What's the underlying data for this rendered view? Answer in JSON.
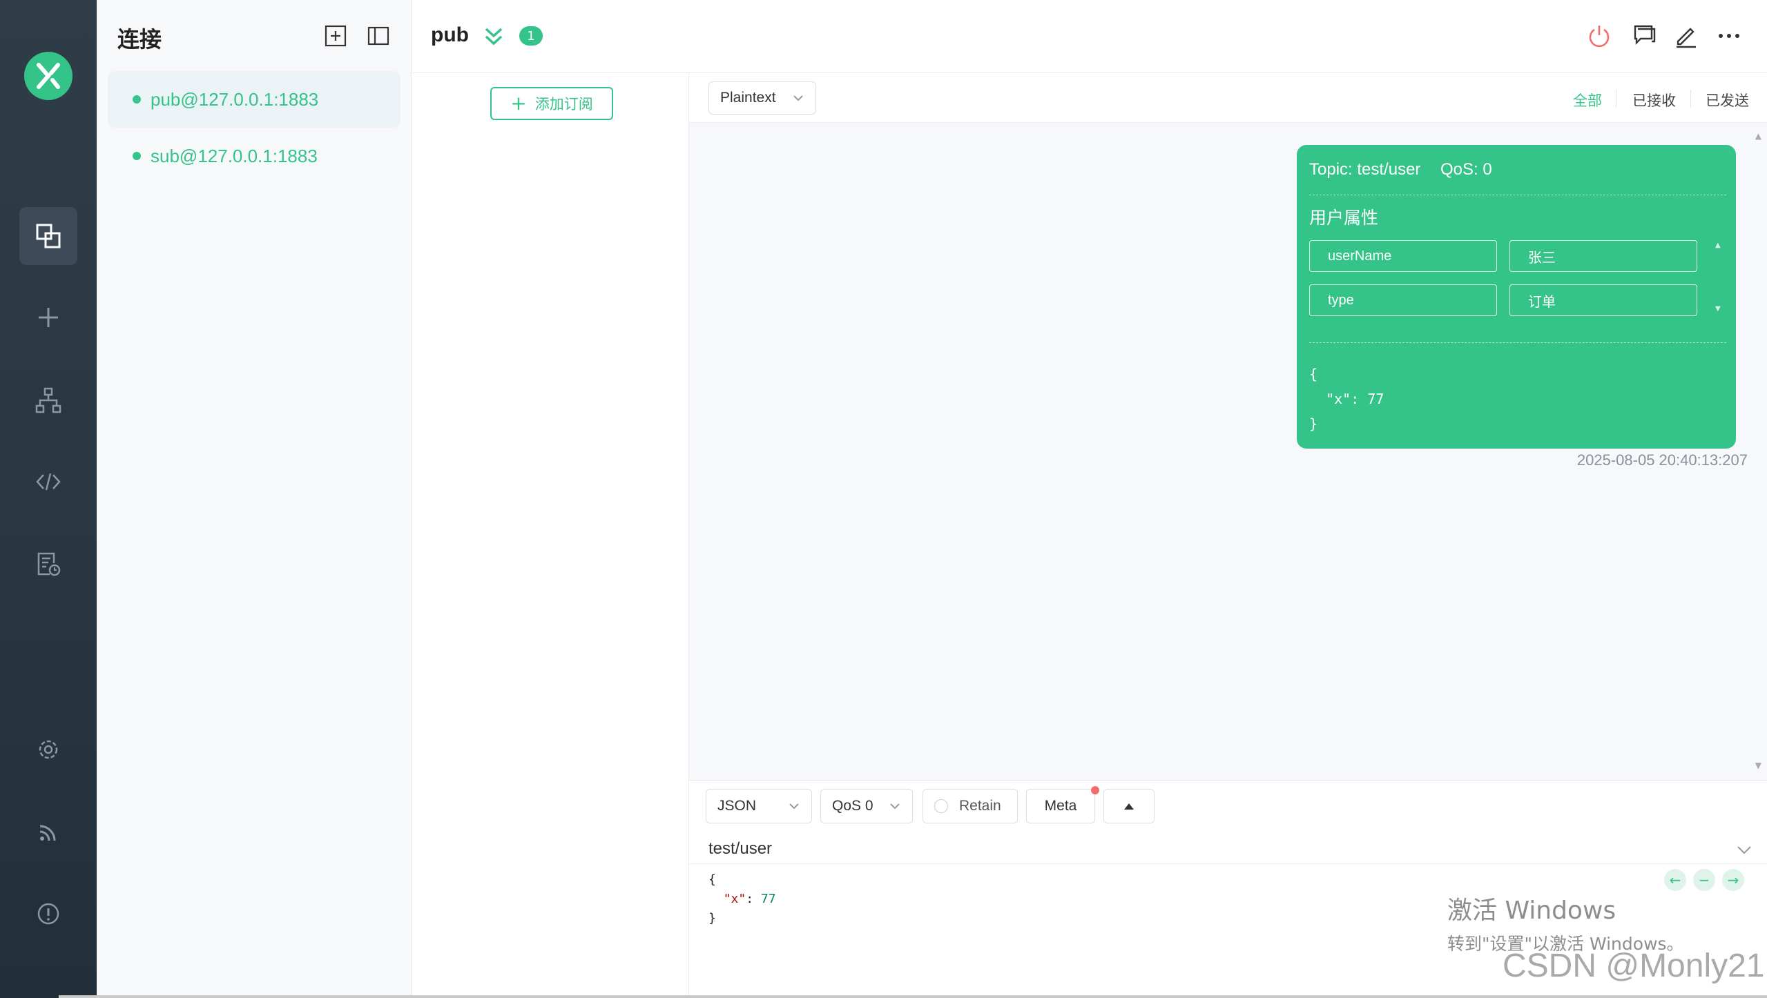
{
  "sidebar": {
    "title": "连接",
    "connections": [
      {
        "name": "pub@127.0.0.1:1883",
        "active": true
      },
      {
        "name": "sub@127.0.0.1:1883",
        "active": false
      }
    ]
  },
  "header": {
    "connection_name": "pub",
    "badge_count": "1"
  },
  "subscriptions": {
    "add_label": "添加订阅"
  },
  "toolbar": {
    "format": "Plaintext",
    "filters": [
      "全部",
      "已接收",
      "已发送"
    ],
    "active_filter": "全部"
  },
  "messages": [
    {
      "topic": "Topic: test/user",
      "qos": "QoS: 0",
      "props_title": "用户属性",
      "properties": [
        {
          "key": "userName",
          "value": "张三"
        },
        {
          "key": "type",
          "value": "订单"
        }
      ],
      "payload": "{\n  \"x\": 77\n}",
      "time": "2025-08-05 20:40:13:207"
    }
  ],
  "composer": {
    "format": "JSON",
    "qos": "QoS 0",
    "retain": "Retain",
    "meta": "Meta",
    "topic": "test/user",
    "payload": {
      "open": "{",
      "key": "\"x\"",
      "sep": ": ",
      "value": "77",
      "close": "}"
    }
  },
  "watermarks": {
    "windows_line1": "激活 Windows",
    "windows_line2": "转到\"设置\"以激活 Windows。",
    "csdn": "CSDN @Monly21"
  },
  "colors": {
    "accent": "#34c388",
    "rail": "#2b3944",
    "danger": "#f56c6c"
  }
}
